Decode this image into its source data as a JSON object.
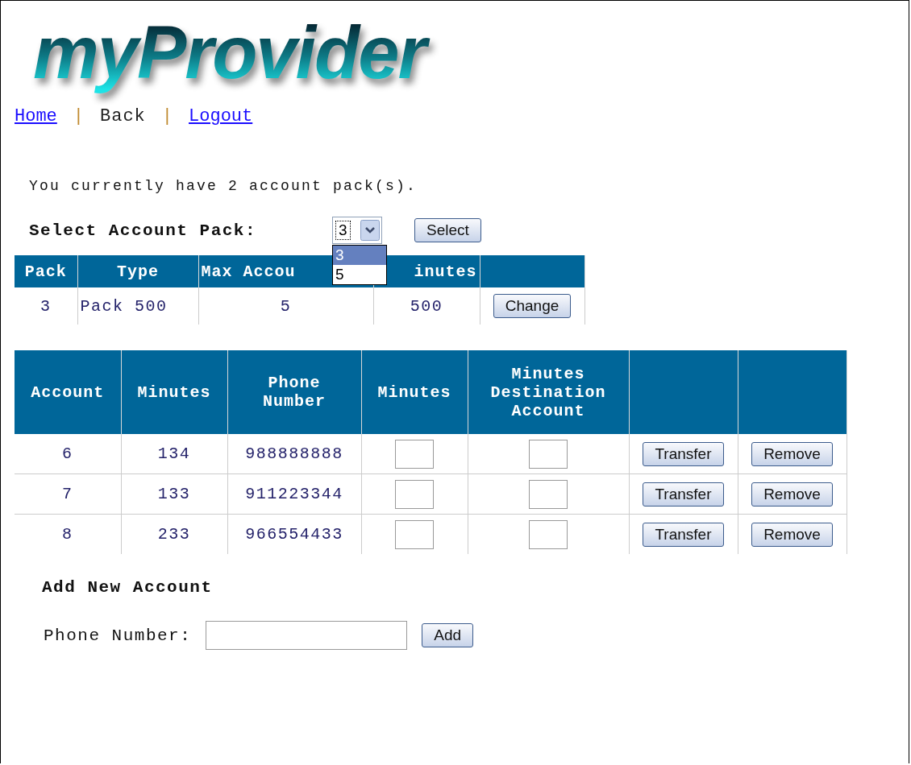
{
  "logo": "myProvider",
  "nav": [
    {
      "label": "Home",
      "kind": "link"
    },
    {
      "label": "|",
      "kind": "separator"
    },
    {
      "label": "Back",
      "kind": "text"
    },
    {
      "label": "|",
      "kind": "separator"
    },
    {
      "label": "Logout",
      "kind": "link"
    }
  ],
  "summary": "You currently have 2 account pack(s).",
  "pack_select": {
    "label": "Select Account Pack:",
    "value": "3",
    "options": [
      {
        "label": "3",
        "selected": true
      },
      {
        "label": "5",
        "selected": false
      }
    ],
    "button": "Select"
  },
  "pack_table": {
    "columns": [
      "Pack",
      "Type",
      "Max Accou",
      "inutes"
    ],
    "rows": [
      {
        "cells": [
          "3",
          "Pack 500",
          "5",
          "500"
        ],
        "button": "Change"
      }
    ]
  },
  "accounts_table": {
    "columns": [
      "Account",
      "Minutes",
      "Phone Number",
      "Minutes",
      "Minutes Destination Account"
    ],
    "rows": [
      {
        "account": "6",
        "minutes": "134",
        "phone": "988888888",
        "buttons": [
          "Transfer",
          "Remove"
        ]
      },
      {
        "account": "7",
        "minutes": "133",
        "phone": "911223344",
        "buttons": [
          "Transfer",
          "Remove"
        ]
      },
      {
        "account": "8",
        "minutes": "233",
        "phone": "966554433",
        "buttons": [
          "Transfer",
          "Remove"
        ]
      }
    ]
  },
  "add_account": {
    "title": "Add New Account",
    "label": "Phone Number:",
    "button": "Add"
  }
}
